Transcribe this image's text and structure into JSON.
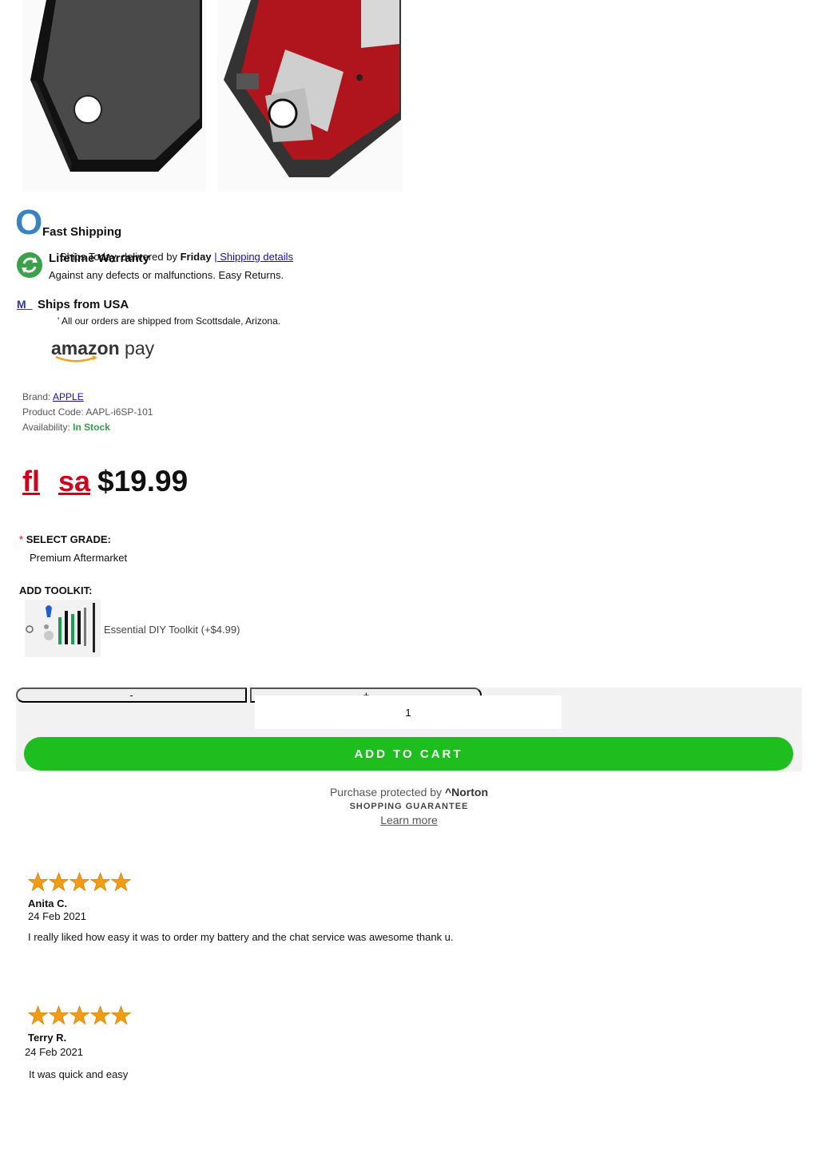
{
  "features": {
    "fast_shipping": {
      "icon_letter": "O",
      "title": "Fast Shipping",
      "detail_prefix": "Ships Today, delivered by ",
      "detail_day": "Friday",
      "detail_sep": " |",
      "detail_link": " Shipping details"
    },
    "warranty": {
      "title": "Lifetime Warranty",
      "text": "Against any defects or malfunctions. Easy Returns."
    },
    "usa": {
      "icon_letter": "M_",
      "title": "Ships from USA",
      "text": "' All our orders are shipped from Scottsdale, Arizona."
    }
  },
  "payment": {
    "brand_a": "amazon",
    "brand_b": " pay"
  },
  "details": {
    "brand_label": "Brand: ",
    "brand_value": "APPLE",
    "code_label": "Product Code: ",
    "code_value": "AAPL-i6SP-101",
    "avail_label": "Availability: ",
    "avail_value": "In Stock"
  },
  "price": {
    "old_a": "fl",
    "old_b": "sa",
    "current": "$19.99"
  },
  "options": {
    "required_mark": "*",
    "grade_label": "SELECT GRADE:",
    "grade_value": "Premium Aftermarket",
    "toolkit_label": "ADD TOOLKIT:",
    "toolkit_option": "Essential DIY Toolkit (+$4.99)"
  },
  "cart": {
    "minus": "-",
    "plus": "+",
    "quantity": "1",
    "add_label": "ADD TO CART"
  },
  "norton": {
    "line_a": "Purchase protected by ",
    "brand": "^Norton",
    "line_b": "SHOPPING GUARANTEE",
    "link": "Learn more"
  },
  "reviews": [
    {
      "rating": 5,
      "name": "Anita C.",
      "date": "24 Feb 2021",
      "text": "I really liked how easy it was to order my battery and the chat service was awesome thank u."
    },
    {
      "rating": 5,
      "name": "Terry R.",
      "date": "24 Feb 2021",
      "text": "It was quick and easy"
    }
  ],
  "colors": {
    "accent_red": "#d0021b",
    "cart_green": "#1ebe1e",
    "in_stock_green": "#3a9a4a",
    "star_orange": "#f39c12",
    "link_blue": "#1a0dab"
  }
}
